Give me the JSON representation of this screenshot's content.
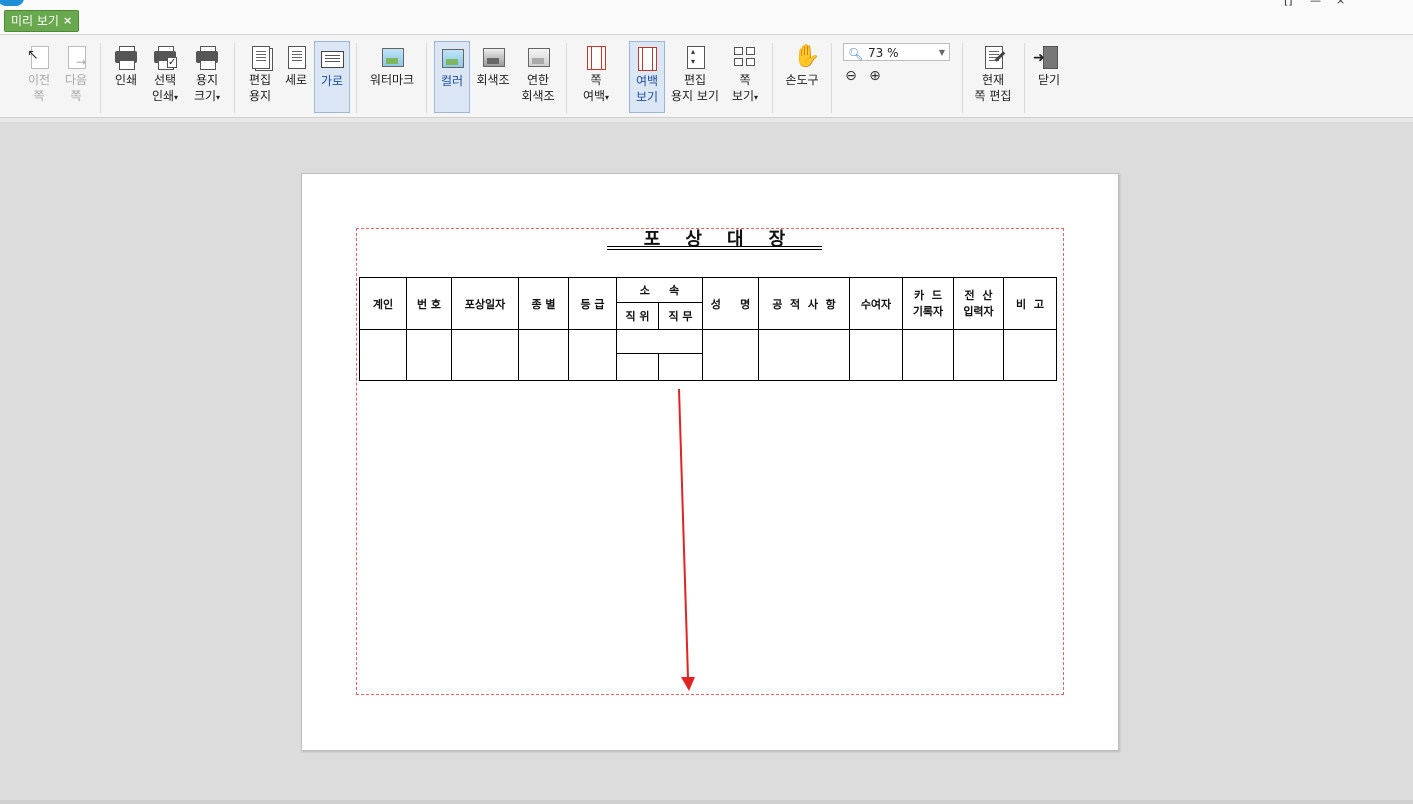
{
  "tab": {
    "label": "미리 보기",
    "close": "×"
  },
  "window_controls": [
    "[]",
    "—",
    "×"
  ],
  "toolbar": {
    "prev_page": "이전\n쪽",
    "next_page": "다음\n쪽",
    "print": "인쇄",
    "selective_print": "선택\n인쇄",
    "paper_size": "용지\n크기",
    "edit_paper": "편집\n용지",
    "portrait": "세로",
    "landscape": "가로",
    "watermark": "워터마크",
    "color": "컬러",
    "grayscale": "회색조",
    "light_grayscale": "연한\n회색조",
    "page_margin": "쪽\n여백",
    "show_margin": "여백\n보기",
    "edit_paper_view": "편집\n용지 보기",
    "page_view": "쪽\n보기",
    "hand_tool": "손도구",
    "zoom_value": "73 %",
    "edit_current_page": "현재\n쪽 편집",
    "close": "닫기"
  },
  "document": {
    "title": "포    상    대    장",
    "headers": {
      "gyein": "계인",
      "bunho": "번 호",
      "date": "포상일자",
      "type": "종 별",
      "grade": "등 급",
      "affiliation": "소     속",
      "position": "직 위",
      "duty": "직 무",
      "name": "성     명",
      "merit": "공  적  사  항",
      "awarder": "수여자",
      "card_recorder": "카  드\n기록자",
      "computer_entry": "전  산\n입력자",
      "remarks": "비  고"
    }
  },
  "colors": {
    "tab_green": "#6aa84f",
    "margin_dashed": "#dd6666",
    "annotation_arrow": "#e02424",
    "active_button": "#dbe6f7"
  }
}
